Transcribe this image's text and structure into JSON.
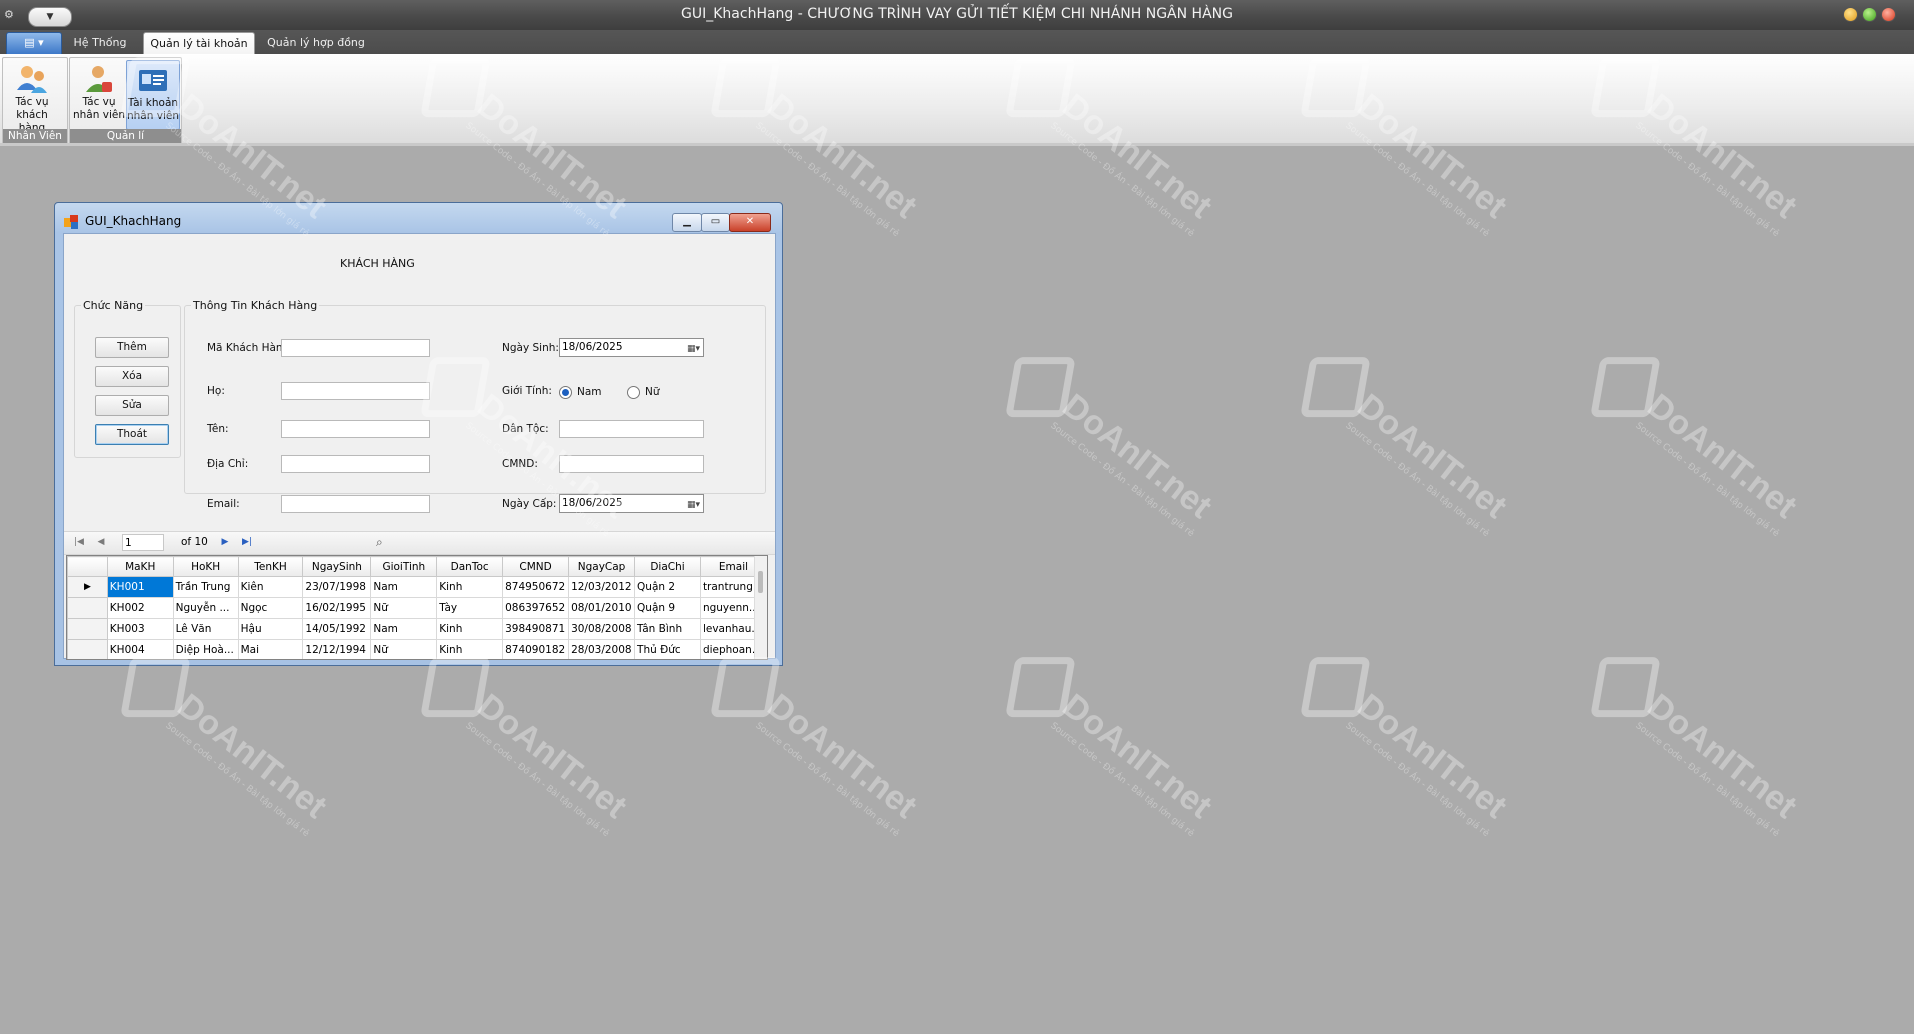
{
  "window": {
    "title": "GUI_KhachHang - CHƯƠNG TRÌNH VAY GỬI TIẾT KIỆM CHI NHÁNH NGÂN HÀNG"
  },
  "tabs": [
    "Hệ Thống",
    "Quản lý tài khoản",
    "Quản lý hợp đồng"
  ],
  "active_tab": "Quản lý tài khoản",
  "ribbon": {
    "group_nhanvien": {
      "label": "Nhân Viên",
      "items": [
        {
          "label": "Tác vụ khách hàng"
        }
      ]
    },
    "group_quanly": {
      "label": "Quản lí",
      "items": [
        {
          "label": "Tác vụ nhân viên"
        },
        {
          "label": "Tài khoản nhân viên"
        }
      ]
    }
  },
  "dialog": {
    "title": "GUI_KhachHang",
    "heading": "KHÁCH HÀNG",
    "chucnang": {
      "legend": "Chức Năng",
      "buttons": [
        "Thêm",
        "Xóa",
        "Sửa",
        "Thoát"
      ]
    },
    "thongtin": {
      "legend": "Thông Tin Khách Hàng",
      "labels": {
        "makh": "Mã Khách Hàng:",
        "ho": "Họ:",
        "ten": "Tên:",
        "diachi": "Địa Chỉ:",
        "email": "Email:",
        "ngaysinh": "Ngày Sinh:",
        "gioitinh": "Giới Tính:",
        "dantoc": "Dân Tộc:",
        "cmnd": "CMND:",
        "ngaycap": "Ngày Cấp:"
      },
      "values": {
        "ngaysinh": "18/06/2025",
        "ngaycap": "18/06/2025"
      },
      "gender_options": [
        "Nam",
        "Nữ"
      ],
      "gender_selected": "Nam"
    },
    "navigator": {
      "position": "1",
      "of_text": "of 10"
    },
    "grid": {
      "columns": [
        "MaKH",
        "HoKH",
        "TenKH",
        "NgaySinh",
        "GioiTinh",
        "DanToc",
        "CMND",
        "NgayCap",
        "DiaChi",
        "Email"
      ],
      "rows": [
        [
          "KH001",
          "Trần Trung",
          "Kiên",
          "23/07/1998",
          "Nam",
          "Kinh",
          "874950672",
          "12/03/2012",
          "Quận 2",
          "trantrung..."
        ],
        [
          "KH002",
          "Nguyễn ...",
          "Ngọc",
          "16/02/1995",
          "Nữ",
          "Tày",
          "086397652",
          "08/01/2010",
          "Quận 9",
          "nguyenn..."
        ],
        [
          "KH003",
          "Lê Văn",
          "Hậu",
          "14/05/1992",
          "Nam",
          "Kinh",
          "398490871",
          "30/08/2008",
          "Tân Bình",
          "levanhau..."
        ],
        [
          "KH004",
          "Diệp Hoà...",
          "Mai",
          "12/12/1994",
          "Nữ",
          "Kinh",
          "874090182",
          "28/03/2008",
          "Thủ Đức",
          "diephoan..."
        ]
      ],
      "selected_row": 0
    }
  },
  "watermark": {
    "text": "DoAnIT.net",
    "sub": "Source Code - Đồ Án - Bài tập lớn giá rẻ"
  },
  "colors": {
    "background": "#ababab",
    "selection": "#0078d7",
    "titlebar": "#4a4a4a"
  }
}
